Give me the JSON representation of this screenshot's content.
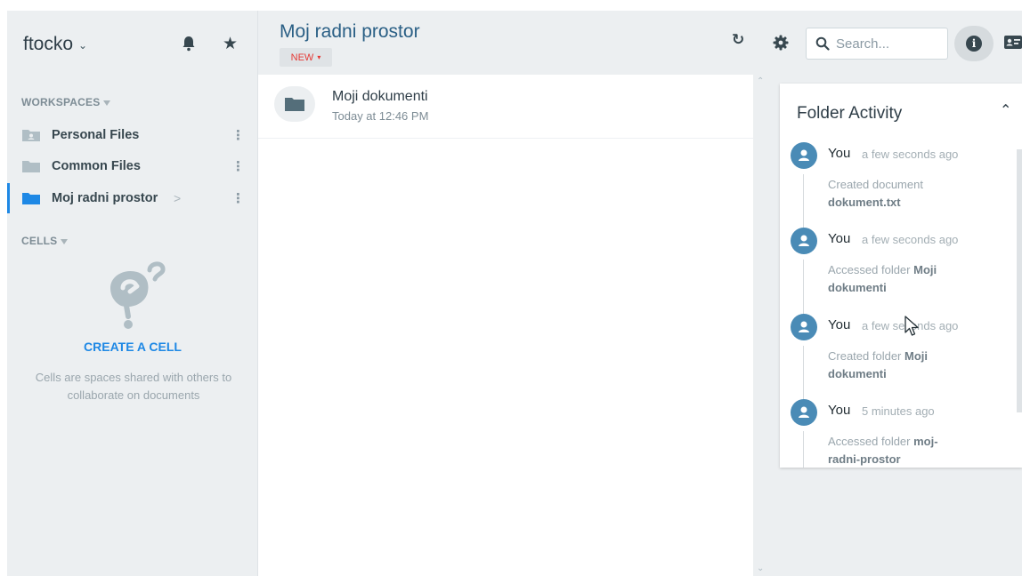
{
  "user": {
    "name": "ftocko"
  },
  "sidebar": {
    "workspaces_label": "WORKSPACES",
    "workspaces": [
      {
        "label": "Personal Files",
        "icon": "folder-user-icon",
        "active": false
      },
      {
        "label": "Common Files",
        "icon": "folder-icon",
        "active": false
      },
      {
        "label": "Moj radni prostor",
        "icon": "folder-icon",
        "active": true
      }
    ],
    "cells_label": "CELLS",
    "create_cell": "CREATE A CELL",
    "cells_description": "Cells are spaces shared with others to collaborate on documents"
  },
  "header": {
    "title": "Moj radni prostor",
    "new_label": "NEW",
    "search_placeholder": "Search..."
  },
  "files": [
    {
      "name": "Moji dokumenti",
      "date": "Today at 12:46 PM",
      "icon": "folder-icon"
    }
  ],
  "activity": {
    "title": "Folder Activity",
    "items": [
      {
        "user": "You",
        "time": "a few seconds ago",
        "action": "Created document",
        "target": "dokument.txt"
      },
      {
        "user": "You",
        "time": "a few seconds ago",
        "action": "Accessed folder",
        "target": "Moji dokumenti"
      },
      {
        "user": "You",
        "time": "a few seconds ago",
        "action": "Created folder",
        "target": "Moji dokumenti"
      },
      {
        "user": "You",
        "time": "5 minutes ago",
        "action": "Accessed folder",
        "target": "moj-radni-prostor"
      }
    ]
  },
  "colors": {
    "accent": "#1e88e5",
    "new_label": "#e53935",
    "title": "#2a5f85",
    "avatar": "#4a8bb6",
    "sidebar_bg": "#eceff1"
  }
}
